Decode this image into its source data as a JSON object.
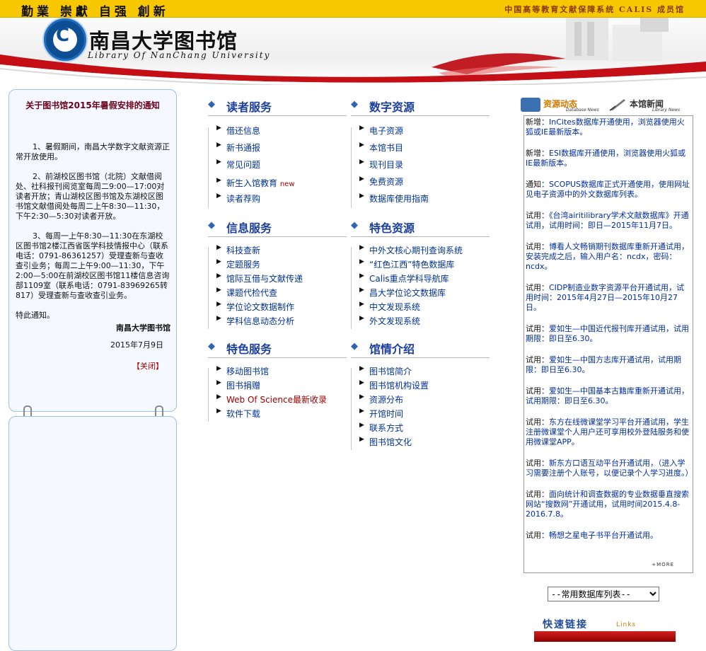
{
  "topbar": {
    "motto": "勤業 崇獻 自强 創新",
    "calis": "中国高等教育文献保障系统 CALIS 成员馆"
  },
  "header": {
    "logo_cn": "南昌大学图书馆",
    "logo_en": "Library Of NanChang University"
  },
  "notice": {
    "title": "关于图书馆2015年暑假安排的通知",
    "paragraphs": [
      "1、暑假期间，南昌大学数字文献资源正常开放使用。",
      "2、前湖校区图书馆（北院）文献借阅处、社科报刊阅览室每周二9:00—17:00对读者开放；青山湖校区图书馆及东湖校区图书馆文献借阅处每周二上午8:30—11:30，下午2:30—5:30对读者开放。",
      "3、每周一上午8:30—11:30在东湖校区图书馆2楼江西省医学科技情报中心（联系电话：0791-86361257）受理查新与查收查引业务；每周二上午9:00—11:30，下午2:00—5:00在前湖校区图书馆11楼信息咨询部1109室（联系电话：0791-83969265转817）受理查新与查收查引业务。"
    ],
    "special": "特此通知。",
    "signature": "南昌大学图书馆",
    "date": "2015年7月9日",
    "close": "【关闭】"
  },
  "sections": {
    "reader": {
      "title": "读者服务",
      "items": [
        "借还信息",
        "新书通报",
        "常见问题",
        "新生入馆教育",
        "读者荐购"
      ],
      "new_badge": "new"
    },
    "digital": {
      "title": "数字资源",
      "items": [
        "电子资源",
        "本馆书目",
        "现刊目录",
        "免费资源",
        "数据库使用指南"
      ]
    },
    "info": {
      "title": "信息服务",
      "items": [
        "科技查新",
        "定题服务",
        "馆际互借与文献传递",
        "课题代检代查",
        "学位论文数据制作",
        "学科信息动态分析"
      ]
    },
    "special_res": {
      "title": "特色资源",
      "items": [
        "中外文核心期刊查询系统",
        "“红色江西”特色数据库",
        "Calis重点学科导航库",
        "昌大学位论文数据库",
        "中文发现系统",
        "外文发现系统"
      ]
    },
    "special_svc": {
      "title": "特色服务",
      "items": [
        "移动图书馆",
        "图书捐赠",
        "Web Of Science最新收录",
        "软件下载"
      ]
    },
    "about": {
      "title": "馆情介绍",
      "items": [
        "图书馆简介",
        "图书馆机构设置",
        "资源分布",
        "开馆时间",
        "联系方式",
        "图书馆文化"
      ]
    }
  },
  "right": {
    "tab1": {
      "label": "资源动态",
      "sub": "Database News"
    },
    "tab2": {
      "label": "本馆新闻",
      "sub": "Library News"
    },
    "news": [
      {
        "prefix": "新增",
        "text": "：InCites数据库开通使用，浏览器使用火狐或IE最新版本。"
      },
      {
        "prefix": "新增",
        "text": "：ESI数据库开通使用，浏览器使用火狐或IE最新版本。"
      },
      {
        "prefix": "通知",
        "text": "：SCOPUS数据库正式开通使用，使用网址见电子资源中的外文数据库列表。"
      },
      {
        "prefix": "试用",
        "text": "：《台湾airitilibrary学术文献数据库》开通试用，试用时间：即日—2015年11月7日。"
      },
      {
        "prefix": "试用",
        "text": "：博看人文畅销期刊数据库重新开通试用，安装完成之后，输入用户名：ncdx，密码：ncdx。"
      },
      {
        "prefix": "试用",
        "text": "：CIDP制造业数字资源平台开通试用，试用时间：2015年4月27日—2015年10月27日。"
      },
      {
        "prefix": "试用",
        "text": "：爱如生—中国近代报刊库开通试用，试用期限：即日至6.30。"
      },
      {
        "prefix": "试用",
        "text": "：爱如生—中国方志库开通试用，试用期限：即日至6.30。"
      },
      {
        "prefix": "试用",
        "text": "：爱如生—中国基本古籍库重新开通试用，试用期限：即日至6.30。"
      },
      {
        "prefix": "试用",
        "text": "：东方在线微课堂学习平台开通试用，学生注册微课堂个人用户还可享用校外登陆服务和使用微课堂APP。"
      },
      {
        "prefix": "试用",
        "text": "：新东方口语互动平台开通试用，（进入学习需要注册个人账号，以便记录个人学习进度。）"
      },
      {
        "prefix": "试用",
        "text": "：面向统计和调查数据的专业数据垂直搜索网站“搜数网”开通试用，试用时间2015.4.8-2016.7.8。"
      },
      {
        "prefix": "试用",
        "text": "：畅想之星电子书平台开通试用。"
      }
    ],
    "more": "+MORE",
    "select_value": "--常用数据库列表--",
    "links_label": "快速链接",
    "links_sub": "Links"
  }
}
